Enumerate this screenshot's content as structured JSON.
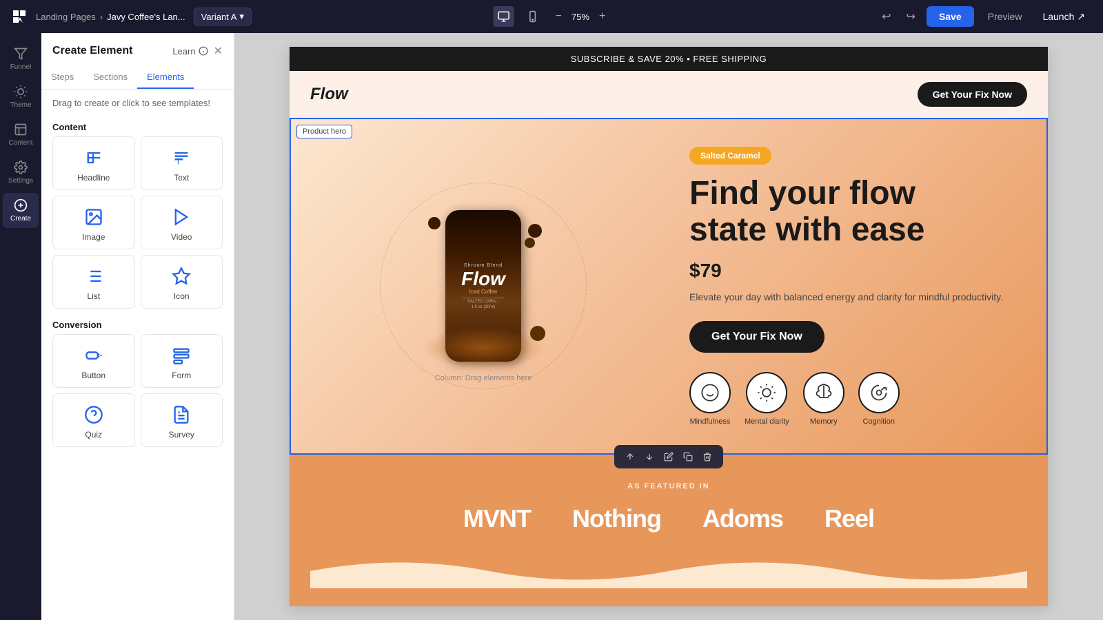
{
  "topbar": {
    "logo_icon": "funnel-icon",
    "breadcrumb_parent": "Landing Pages",
    "breadcrumb_separator": "›",
    "breadcrumb_current": "Javy Coffee's Lan...",
    "variant_label": "Variant A",
    "zoom_value": "75%",
    "zoom_minus": "−",
    "zoom_plus": "+",
    "undo_label": "↩",
    "redo_label": "↪",
    "save_label": "Save",
    "preview_label": "Preview",
    "launch_label": "Launch ↗"
  },
  "icon_sidebar": {
    "items": [
      {
        "id": "funnel",
        "label": "Funnel",
        "icon": "funnel-icon"
      },
      {
        "id": "theme",
        "label": "Theme",
        "icon": "theme-icon"
      },
      {
        "id": "content",
        "label": "Content",
        "icon": "content-icon"
      },
      {
        "id": "settings",
        "label": "Settings",
        "icon": "settings-icon"
      },
      {
        "id": "create",
        "label": "Create",
        "icon": "create-icon",
        "active": true
      }
    ]
  },
  "panel": {
    "title": "Create Element",
    "learn_label": "Learn",
    "close_icon": "close-icon",
    "tabs": [
      {
        "id": "steps",
        "label": "Steps"
      },
      {
        "id": "sections",
        "label": "Sections"
      },
      {
        "id": "elements",
        "label": "Elements",
        "active": true
      }
    ],
    "description": "Drag to create or click to see templates!",
    "content_section": {
      "title": "Content",
      "elements": [
        {
          "id": "headline",
          "label": "Headline",
          "icon": "headline-icon"
        },
        {
          "id": "text",
          "label": "Text",
          "icon": "text-icon"
        },
        {
          "id": "image",
          "label": "Image",
          "icon": "image-icon"
        },
        {
          "id": "video",
          "label": "Video",
          "icon": "video-icon"
        },
        {
          "id": "list",
          "label": "List",
          "icon": "list-icon"
        },
        {
          "id": "icon",
          "label": "Icon",
          "icon": "star-icon"
        }
      ]
    },
    "conversion_section": {
      "title": "Conversion",
      "elements": [
        {
          "id": "button",
          "label": "Button",
          "icon": "button-icon"
        },
        {
          "id": "form",
          "label": "Form",
          "icon": "form-icon"
        },
        {
          "id": "quiz",
          "label": "Quiz",
          "icon": "quiz-icon"
        },
        {
          "id": "survey",
          "label": "Survey",
          "icon": "survey-icon"
        }
      ]
    }
  },
  "canvas": {
    "announcement": "SUBSCRIBE & SAVE 20% • FREE SHIPPING",
    "logo": "Flow",
    "nav_cta": "Get Your Fix Now",
    "product_hero_label": "Product hero",
    "hero": {
      "badge": "Salted Caramel",
      "headline_line1": "Find your flow",
      "headline_line2": "state with ease",
      "price": "$79",
      "description": "Elevate your day with balanced energy and clarity for mindful productivity.",
      "cta_button": "Get Your Fix Now",
      "column_hint": "Column: Drag elements here",
      "product_name": "Flow",
      "product_sub": "Iced Coffee",
      "product_blend": "Shroom Blend",
      "icons": [
        {
          "id": "mood",
          "label": "Mindfulness",
          "icon": "mood-icon"
        },
        {
          "id": "mental",
          "label": "Mental clarity",
          "icon": "sun-icon"
        },
        {
          "id": "memory",
          "label": "Memory",
          "icon": "brain-icon"
        },
        {
          "id": "cognition",
          "label": "Cognition",
          "icon": "head-icon"
        }
      ]
    },
    "featured": {
      "label": "AS FEATURED IN",
      "logos": [
        "MVNT",
        "Nothing",
        "Adoms",
        "Reel"
      ]
    }
  },
  "floating_toolbar": {
    "buttons": [
      {
        "id": "up",
        "icon": "arrow-up-icon",
        "label": "↑"
      },
      {
        "id": "down",
        "icon": "arrow-down-icon",
        "label": "↓"
      },
      {
        "id": "edit",
        "icon": "edit-icon",
        "label": "✏"
      },
      {
        "id": "duplicate",
        "icon": "duplicate-icon",
        "label": "⧉"
      },
      {
        "id": "delete",
        "icon": "delete-icon",
        "label": "🗑"
      }
    ]
  },
  "colors": {
    "accent_blue": "#2563eb",
    "topbar_bg": "#1a1a2e",
    "hero_gradient_start": "#fde8d0",
    "hero_gradient_end": "#e8975a",
    "cta_bg": "#1a1a1a",
    "badge_color": "#f5a623",
    "featured_bg": "#e8975a"
  }
}
